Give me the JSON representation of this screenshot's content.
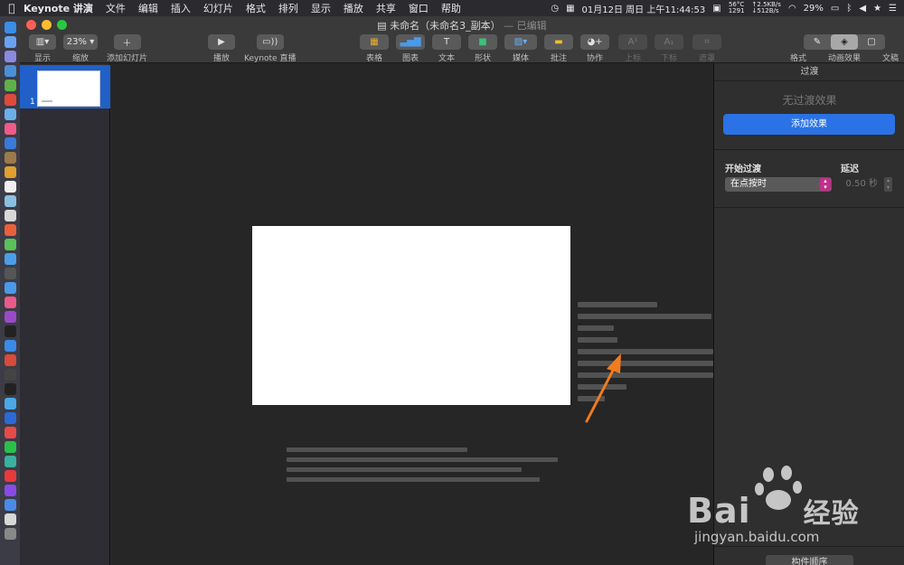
{
  "menubar": {
    "app_name": "Keynote 讲演",
    "items": [
      "文件",
      "编辑",
      "插入",
      "幻灯片",
      "格式",
      "排列",
      "显示",
      "播放",
      "共享",
      "窗口",
      "帮助"
    ],
    "temp": "56°C",
    "temp2": "1291",
    "net_up": "↑2.5KB/s",
    "net_down": "↓512B/s",
    "datetime": "01月12日 周日 上午11:44:53",
    "battery": "29%"
  },
  "window": {
    "doc_title": "未命名（未命名3_副本）",
    "edited": "— 已编辑"
  },
  "toolbar": {
    "view_label": "显示",
    "zoom_value": "23%",
    "zoom_label": "缩放",
    "add_slide_label": "添加幻灯片",
    "play_label": "播放",
    "keynote_live_label": "Keynote 直播",
    "table_label": "表格",
    "chart_label": "图表",
    "text_label": "文本",
    "shape_label": "形状",
    "media_label": "媒体",
    "comment_label": "批注",
    "collab_label": "协作",
    "sup_label": "上标",
    "sub_label": "下标",
    "mask_label": "遮罩",
    "format_label": "格式",
    "animate_label": "动画效果",
    "document_label": "文稿"
  },
  "navigator": {
    "slide_number": "1"
  },
  "inspector": {
    "tab": "过渡",
    "no_transition": "无过渡效果",
    "add_effect": "添加效果",
    "start_label": "开始过渡",
    "start_value": "在点按时",
    "delay_label": "延迟",
    "delay_value": "0.50 秒",
    "build_order": "构件顺序"
  },
  "watermark": {
    "brand": "Bai",
    "brand2": "经验",
    "url": "jingyan.baidu.com"
  },
  "colors": {
    "accent": "#2a72e5",
    "arrow": "#f07c1e",
    "select_caret": "#c22e8c"
  }
}
